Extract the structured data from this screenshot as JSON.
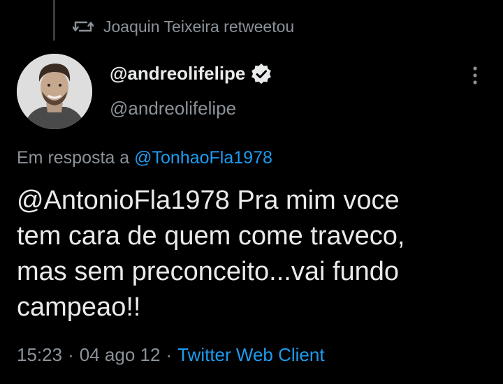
{
  "retweet": {
    "icon": "retweet-icon",
    "text": "Joaquin Teixeira retweetou"
  },
  "tweet": {
    "author_name": "@andreolifelipe",
    "author_handle": "@andreolifelipe",
    "verified_icon": "verified-badge-icon",
    "more_icon": "more-vertical-icon",
    "reply_prefix": "Em resposta a",
    "reply_to": "@TonhaoFla1978",
    "text": "@AntonioFla1978 Pra mim voce\ntem cara de quem come traveco,\nmas sem preconceito...vai fundo\ncampeao!!",
    "time": "15:23",
    "separator1": "·",
    "date": "04 ago 12",
    "separator2": "·",
    "client": "Twitter Web Client"
  },
  "colors": {
    "background": "#000000",
    "text_primary": "#e9eaeb",
    "text_secondary": "#8b9299",
    "link": "#1d9bf0"
  }
}
